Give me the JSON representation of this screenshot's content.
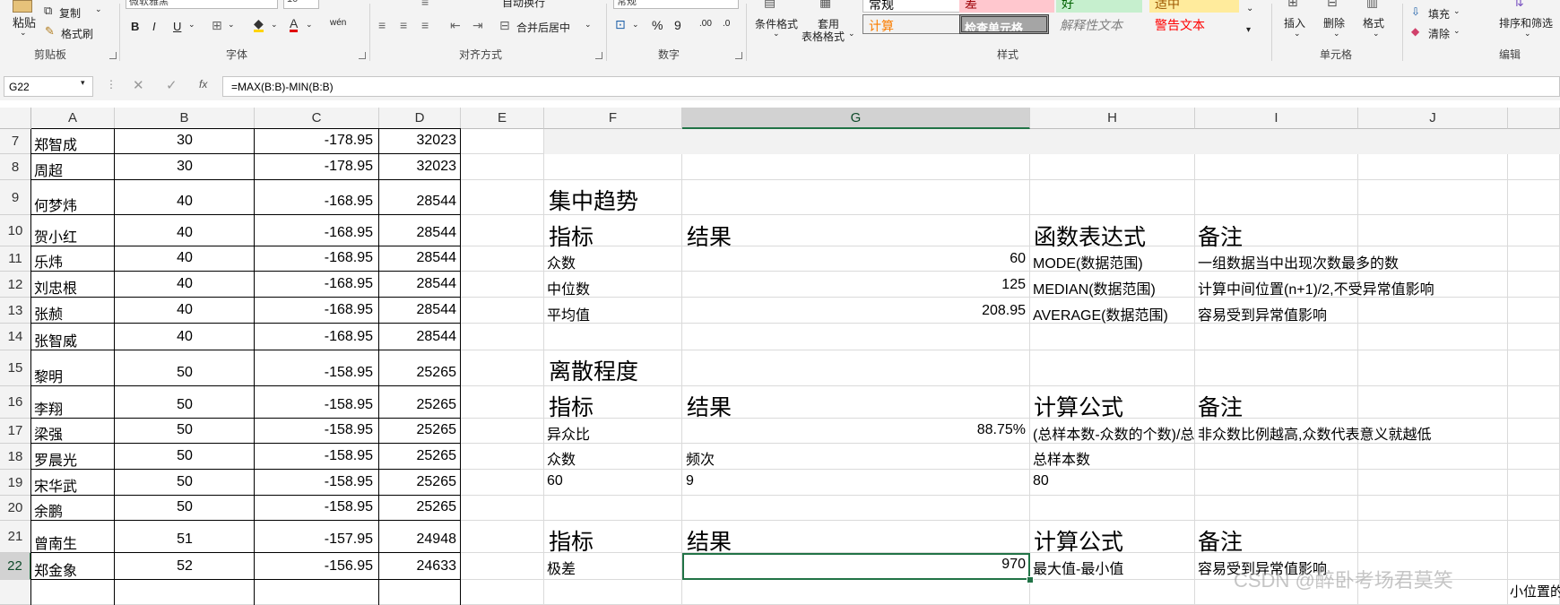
{
  "ribbon": {
    "clipboard": {
      "paste": "粘贴",
      "copy": "复制",
      "format_painter": "格式刷",
      "label": "剪贴板"
    },
    "font": {
      "name": "微软雅黑",
      "size": "10",
      "bold": "B",
      "italic": "I",
      "underline": "U",
      "label": "字体",
      "phonetic": "wén"
    },
    "alignment": {
      "wrap": "自动换行",
      "merge": "合并后居中",
      "label": "对齐方式"
    },
    "number": {
      "format": "常规",
      "percent": "%",
      "comma": "9",
      "label": "数字"
    },
    "styles": {
      "cond_format": "条件格式",
      "table_format_1": "套用",
      "table_format_2": "表格格式",
      "normal": "常规",
      "bad": "差",
      "good": "好",
      "neutral": "适中",
      "calc": "计算",
      "check": "检查单元格",
      "explanatory": "解释性文本",
      "warning": "警告文本",
      "label": "样式"
    },
    "cells": {
      "insert": "插入",
      "delete": "删除",
      "format": "格式",
      "label": "单元格"
    },
    "editing": {
      "fill": "填充",
      "clear": "清除",
      "sort": "排序和筛选",
      "label": "编辑"
    }
  },
  "formula_bar": {
    "namebox": "G22",
    "fx": "fx",
    "formula": "=MAX(B:B)-MIN(B:B)"
  },
  "columns": [
    "A",
    "B",
    "C",
    "D",
    "E",
    "F",
    "G",
    "H",
    "I",
    "J"
  ],
  "rows": [
    {
      "num": "7",
      "a": "郑智成",
      "b": "30",
      "c": "-178.95",
      "d": "32023"
    },
    {
      "num": "8",
      "a": "周超",
      "b": "30",
      "c": "-178.95",
      "d": "32023"
    },
    {
      "num": "9",
      "a": "何梦炜",
      "b": "40",
      "c": "-168.95",
      "d": "28544"
    },
    {
      "num": "10",
      "a": "贺小红",
      "b": "40",
      "c": "-168.95",
      "d": "28544"
    },
    {
      "num": "11",
      "a": "乐炜",
      "b": "40",
      "c": "-168.95",
      "d": "28544"
    },
    {
      "num": "12",
      "a": "刘忠根",
      "b": "40",
      "c": "-168.95",
      "d": "28544"
    },
    {
      "num": "13",
      "a": "张赪",
      "b": "40",
      "c": "-168.95",
      "d": "28544"
    },
    {
      "num": "14",
      "a": "张智威",
      "b": "40",
      "c": "-168.95",
      "d": "28544"
    },
    {
      "num": "15",
      "a": "黎明",
      "b": "50",
      "c": "-158.95",
      "d": "25265"
    },
    {
      "num": "16",
      "a": "李翔",
      "b": "50",
      "c": "-158.95",
      "d": "25265"
    },
    {
      "num": "17",
      "a": "梁强",
      "b": "50",
      "c": "-158.95",
      "d": "25265"
    },
    {
      "num": "18",
      "a": "罗晨光",
      "b": "50",
      "c": "-158.95",
      "d": "25265"
    },
    {
      "num": "19",
      "a": "宋华武",
      "b": "50",
      "c": "-158.95",
      "d": "25265"
    },
    {
      "num": "20",
      "a": "余鹏",
      "b": "50",
      "c": "-158.95",
      "d": "25265"
    },
    {
      "num": "21",
      "a": "曾南生",
      "b": "51",
      "c": "-157.95",
      "d": "24948"
    },
    {
      "num": "22",
      "a": "郑金象",
      "b": "52",
      "c": "-156.95",
      "d": "24633"
    }
  ],
  "central": {
    "title": "集中趋势",
    "h_indicator": "指标",
    "h_result": "结果",
    "h_func": "函数表达式",
    "h_note": "备注",
    "mode": {
      "name": "众数",
      "value": "60",
      "func": "MODE(数据范围)",
      "note": "一组数据当中出现次数最多的数"
    },
    "median": {
      "name": "中位数",
      "value": "125",
      "func": "MEDIAN(数据范围)",
      "note": "计算中间位置(n+1)/2,不受异常值影响"
    },
    "mean": {
      "name": "平均值",
      "value": "208.95",
      "func": "AVERAGE(数据范围)",
      "note": "容易受到异常值影响"
    }
  },
  "dispersion": {
    "title": "离散程度",
    "h_indicator": "指标",
    "h_result": "结果",
    "h_formula": "计算公式",
    "h_note": "备注",
    "variation": {
      "name": "异众比",
      "value": "88.75%",
      "formula": "(总样本数-众数的个数)/总样本数",
      "note": "非众数比例越高,众数代表意义就越低"
    },
    "sub_headers": {
      "mode": "众数",
      "freq": "频次",
      "total": "总样本数"
    },
    "sub_values": {
      "mode": "60",
      "freq": "9",
      "total": "80"
    }
  },
  "range": {
    "h_indicator": "指标",
    "h_result": "结果",
    "h_formula": "计算公式",
    "h_note": "备注",
    "name": "极差",
    "value": "970",
    "formula": "最大值-最小值",
    "note": "容易受到异常值影响"
  },
  "watermark": "CSDN @醉卧考场君莫笑",
  "corner_text": "小位置的"
}
